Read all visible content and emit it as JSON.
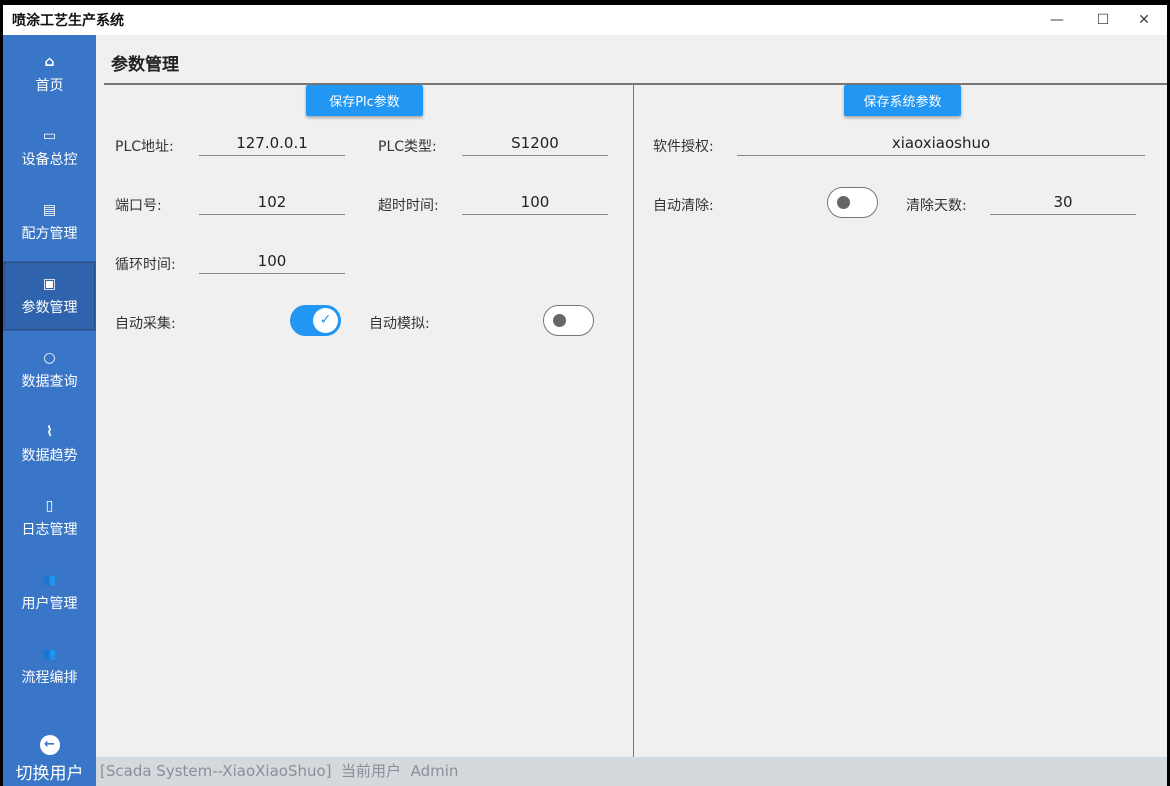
{
  "window": {
    "title": "喷涂工艺生产系统",
    "minimize": "—",
    "maximize": "☐",
    "close": "✕"
  },
  "sidebar": {
    "items": [
      {
        "label": "首页",
        "icon": "⌂"
      },
      {
        "label": "设备总控",
        "icon": "▭"
      },
      {
        "label": "配方管理",
        "icon": "▤"
      },
      {
        "label": "参数管理",
        "icon": "▣"
      },
      {
        "label": "数据查询",
        "icon": "○"
      },
      {
        "label": "数据趋势",
        "icon": "⌇"
      },
      {
        "label": "日志管理",
        "icon": "▯"
      },
      {
        "label": "用户管理",
        "icon": "👥"
      },
      {
        "label": "流程编排",
        "icon": "👥"
      }
    ],
    "switch_user": {
      "label": "切换用户",
      "icon": "←"
    }
  },
  "page": {
    "title": "参数管理"
  },
  "plc": {
    "save_label": "保存Plc参数",
    "address_label": "PLC地址:",
    "address": "127.0.0.1",
    "type_label": "PLC类型:",
    "type": "S1200",
    "port_label": "端口号:",
    "port": "102",
    "timeout_label": "超时时间:",
    "timeout": "100",
    "cycle_label": "循环时间:",
    "cycle": "100",
    "auto_collect_label": "自动采集:",
    "auto_collect": true,
    "auto_sim_label": "自动模拟:",
    "auto_sim": false
  },
  "system": {
    "save_label": "保存系统参数",
    "license_label": "软件授权:",
    "license": "xiaoxiaoshuo",
    "auto_clear_label": "自动清除:",
    "auto_clear": false,
    "clear_days_label": "清除天数:",
    "clear_days": "30"
  },
  "status": {
    "system": "[Scada System--XiaoXiaoShuo]",
    "user_label": "当前用户",
    "user": "Admin"
  }
}
